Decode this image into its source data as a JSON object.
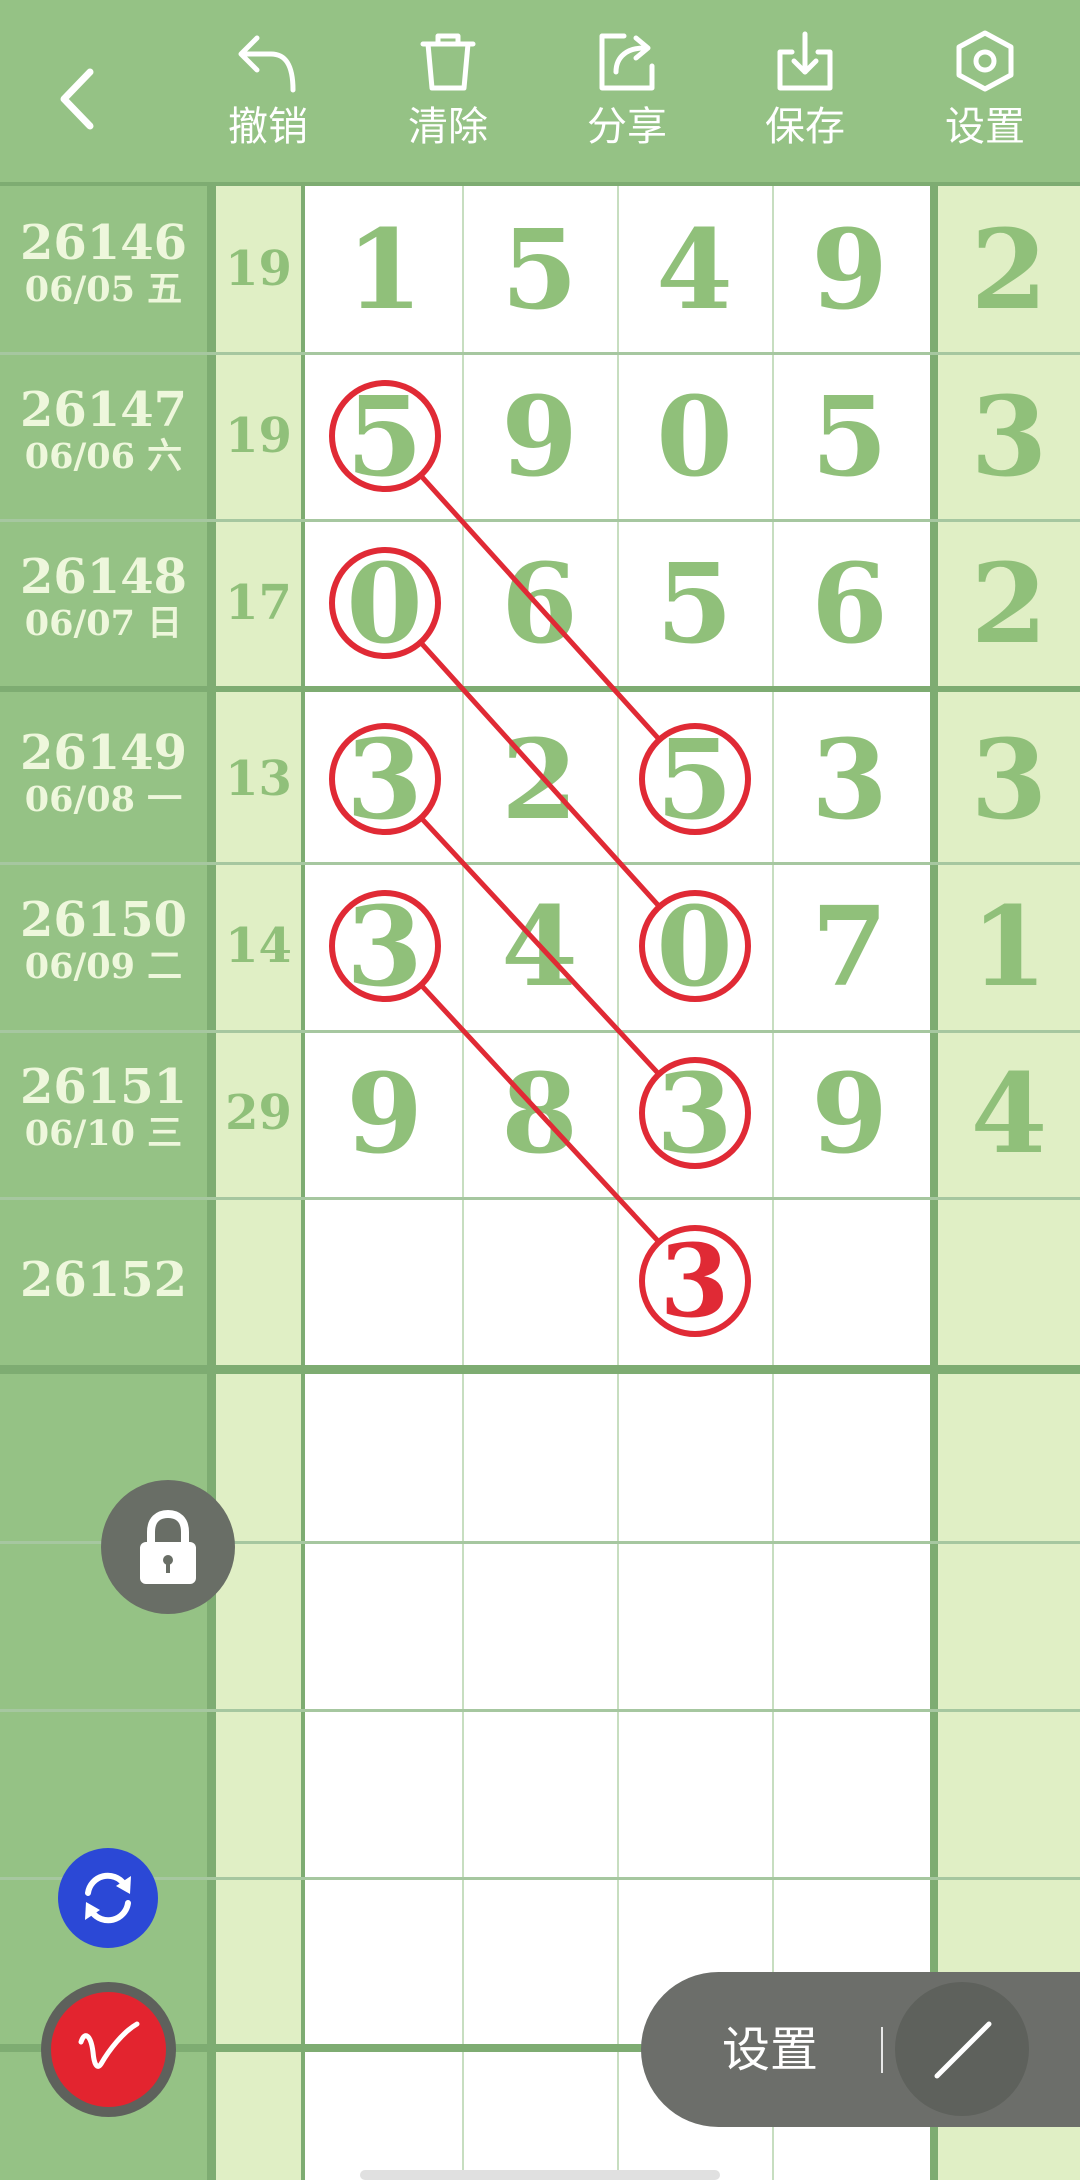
{
  "header": {
    "toolbar": [
      {
        "label": "撤销",
        "icon": "undo-icon"
      },
      {
        "label": "清除",
        "icon": "trash-icon"
      },
      {
        "label": "分享",
        "icon": "share-icon"
      },
      {
        "label": "保存",
        "icon": "download-icon"
      },
      {
        "label": "设置",
        "icon": "settings-icon"
      }
    ]
  },
  "rows": [
    {
      "issue": "26146",
      "date": "06/05 五",
      "sum": "19",
      "digits": [
        "1",
        "5",
        "4",
        "9"
      ],
      "extra": "2"
    },
    {
      "issue": "26147",
      "date": "06/06 六",
      "sum": "19",
      "digits": [
        "5",
        "9",
        "0",
        "5"
      ],
      "extra": "3"
    },
    {
      "issue": "26148",
      "date": "06/07 日",
      "sum": "17",
      "digits": [
        "0",
        "6",
        "5",
        "6"
      ],
      "extra": "2"
    },
    {
      "issue": "26149",
      "date": "06/08 一",
      "sum": "13",
      "digits": [
        "3",
        "2",
        "5",
        "3"
      ],
      "extra": "3"
    },
    {
      "issue": "26150",
      "date": "06/09 二",
      "sum": "14",
      "digits": [
        "3",
        "4",
        "0",
        "7"
      ],
      "extra": "1"
    },
    {
      "issue": "26151",
      "date": "06/10 三",
      "sum": "29",
      "digits": [
        "9",
        "8",
        "3",
        "9"
      ],
      "extra": "4"
    },
    {
      "issue": "26152",
      "date": "",
      "sum": "",
      "digits": [
        "",
        "",
        "3",
        ""
      ],
      "extra": ""
    }
  ],
  "annotations": {
    "circled_cells": [
      [
        1,
        0
      ],
      [
        2,
        0
      ],
      [
        3,
        0
      ],
      [
        4,
        0
      ],
      [
        3,
        2
      ],
      [
        4,
        2
      ],
      [
        5,
        2
      ],
      [
        6,
        2
      ]
    ],
    "lines": [
      [
        [
          1,
          0
        ],
        [
          3,
          2
        ]
      ],
      [
        [
          2,
          0
        ],
        [
          4,
          2
        ]
      ],
      [
        [
          3,
          0
        ],
        [
          5,
          2
        ]
      ],
      [
        [
          4,
          0
        ],
        [
          6,
          2
        ]
      ]
    ],
    "predicted_cell": [
      6,
      2
    ]
  },
  "floating": {
    "lock_icon": "lock-icon",
    "refresh_icon": "refresh-icon",
    "pen_icon": "pen-icon",
    "line_tool_icon": "line-tool-icon",
    "settings_label": "设置"
  },
  "colors": {
    "header_bg": "#95c285",
    "issue_col_bg": "#95c285",
    "sum_col_bg": "#e0efc5",
    "digit_color": "#90c07a",
    "annotation_red": "#e02a35",
    "refresh_blue": "#2b48d6"
  }
}
